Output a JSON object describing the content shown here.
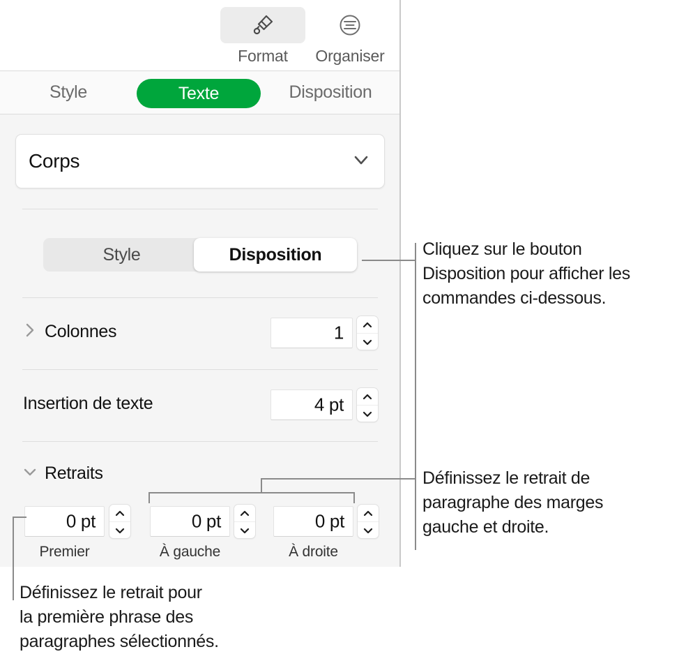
{
  "panel": {
    "toolbar": {
      "buttons": [
        {
          "label": "Format",
          "icon": "paintbrush-icon",
          "active": true
        },
        {
          "label": "Organiser",
          "icon": "align-center-circle-icon",
          "active": false
        }
      ]
    },
    "tabs": [
      {
        "label": "Style",
        "selected": false
      },
      {
        "label": "Texte",
        "selected": true
      },
      {
        "label": "Disposition",
        "selected": false
      }
    ],
    "paragraph_style": {
      "value": "Corps",
      "icon": "chevron-down-icon"
    },
    "segmented_control": [
      {
        "label": "Style",
        "selected": false
      },
      {
        "label": "Disposition",
        "selected": true
      }
    ],
    "rows": {
      "columns": {
        "label": "Colonnes",
        "disclosure": "chevron-right-icon",
        "value": "1"
      },
      "text_inset": {
        "label": "Insertion de texte",
        "value": "4 pt"
      },
      "indents": {
        "label": "Retraits",
        "disclosure": "chevron-down-icon",
        "fields": [
          {
            "caption": "Premier",
            "value": "0 pt"
          },
          {
            "caption": "À gauche",
            "value": "0 pt"
          },
          {
            "caption": "À droite",
            "value": "0 pt"
          }
        ]
      }
    }
  },
  "callouts": [
    {
      "lines": [
        "Cliquez sur le bouton",
        "Disposition pour afficher les",
        "commandes ci-dessous."
      ]
    },
    {
      "lines": [
        "Définissez le retrait de",
        "paragraphe des marges",
        "gauche et droite."
      ]
    },
    {
      "lines": [
        "Définissez le retrait pour",
        "la première phrase des",
        "paragraphes sélectionnés."
      ]
    }
  ],
  "colors": {
    "accent_green": "#00a63c",
    "panel_background": "#f5f5f5",
    "callout_line": "#8a8a8a"
  }
}
